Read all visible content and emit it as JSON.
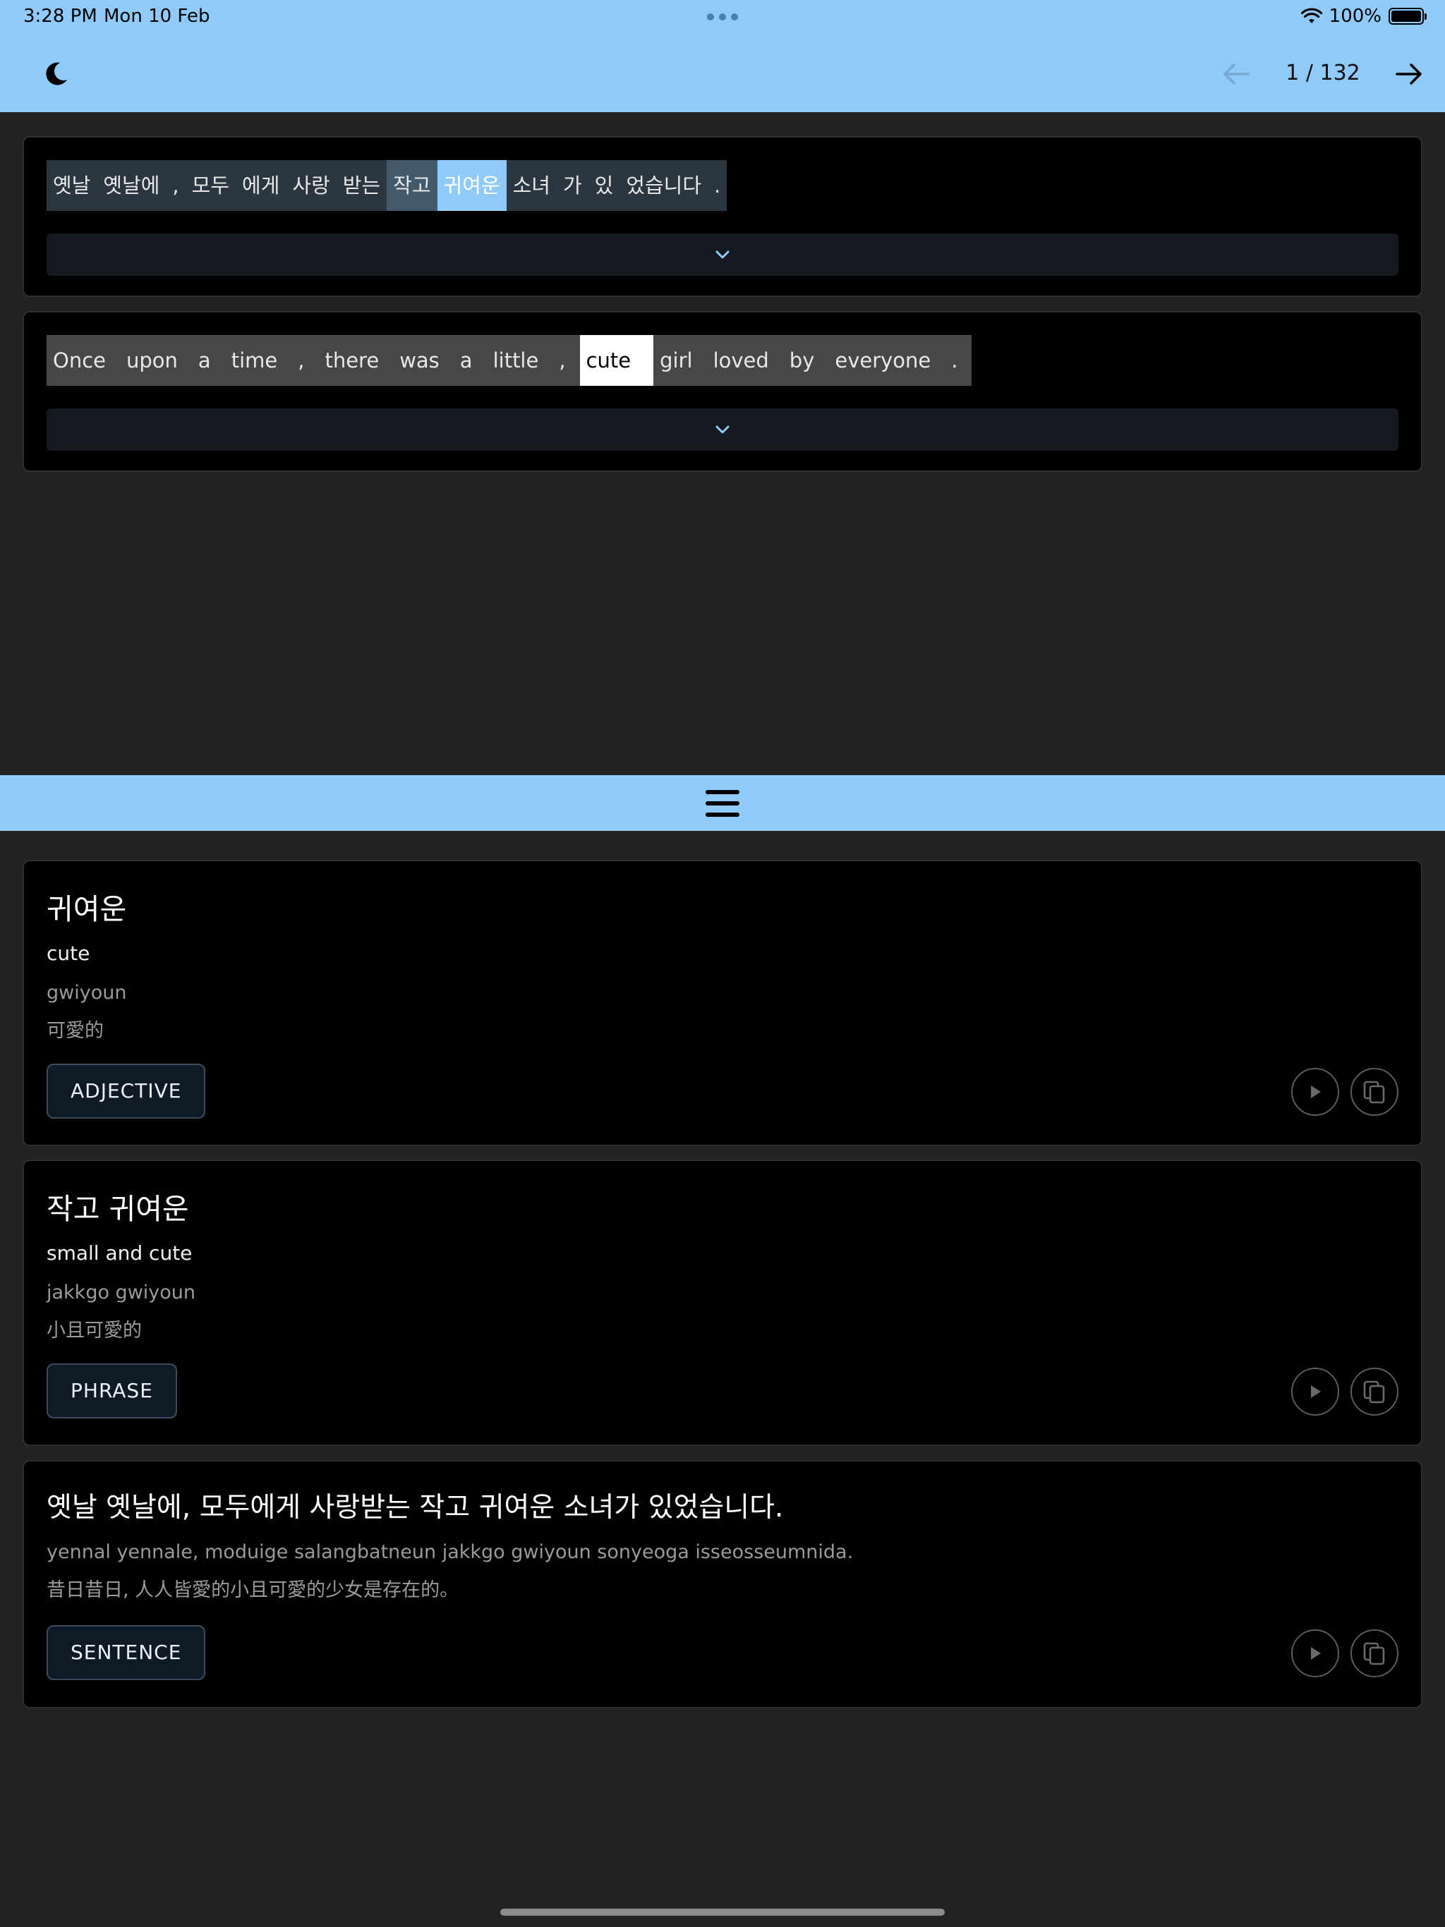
{
  "status_bar": {
    "time": "3:28 PM",
    "date": "Mon 10 Feb",
    "battery": "100%",
    "battery_level": 1.0
  },
  "nav": {
    "page_counter": "1 / 132",
    "icons": {
      "theme": "moon-icon",
      "back": "arrow-left-icon",
      "forward": "arrow-right-icon"
    }
  },
  "korean_tokens": [
    "옛날",
    "옛날에",
    ",",
    "모두",
    "에게",
    "사랑",
    "받는",
    "작고",
    "귀여운",
    "소녀",
    "가",
    "있",
    "었습니다",
    "."
  ],
  "english_tokens": [
    "Once",
    "upon",
    "a",
    "time",
    ",",
    "there",
    "was",
    "a",
    "little",
    ",",
    "cute",
    "girl",
    "loved",
    "by",
    "everyone",
    "."
  ],
  "entries": [
    {
      "head": "귀여운",
      "meaning": "cute",
      "romanization": "gwiyoun",
      "chinese": "可愛的",
      "badge": "ADJECTIVE"
    },
    {
      "head": "작고 귀여운",
      "meaning": "small and cute",
      "romanization": "jakkgo gwiyoun",
      "chinese": "小且可愛的",
      "badge": "PHRASE"
    },
    {
      "head": "옛날 옛날에, 모두에게 사랑받는 작고 귀여운 소녀가 있었습니다.",
      "romanization": "yennal yennale, moduige salangbatneun jakkgo gwiyoun sonyeoga isseosseumnida.",
      "chinese": "昔日昔日, 人人皆愛的小且可愛的少女是存在的。",
      "badge": "SENTENCE"
    }
  ],
  "colors": {
    "accent": "#90caf9",
    "background": "#222222",
    "card": "#000000",
    "highlight_word": "#90caf9",
    "highlight_phrase": "#43596c"
  }
}
